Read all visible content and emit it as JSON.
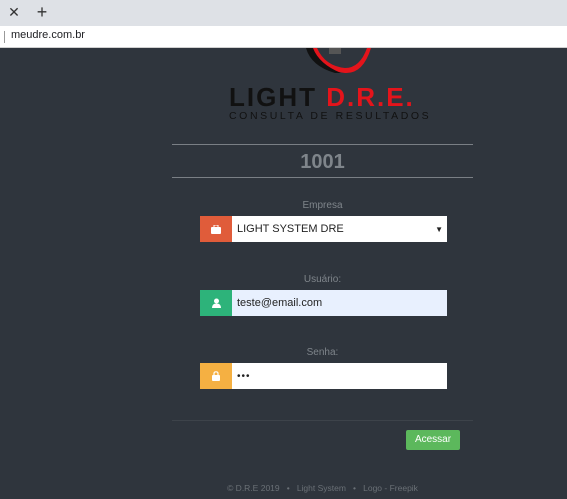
{
  "browser": {
    "close_tab_label": "✕",
    "new_tab_label": "+",
    "url": "meudre.com.br"
  },
  "logo": {
    "title_black": "LIGHT ",
    "title_red": "D.R.E.",
    "subtitle": "CONSULTA DE RESULTADOS",
    "colors": {
      "red": "#e4141b",
      "black": "#111111"
    }
  },
  "code": "1001",
  "empresa": {
    "label": "Empresa",
    "value": "LIGHT SYSTEM DRE",
    "icon": "briefcase-icon",
    "icon_color": "#e05c3a"
  },
  "usuario": {
    "label": "Usuário:",
    "value": "teste@email.com",
    "icon": "user-icon",
    "icon_color": "#2db37a"
  },
  "senha": {
    "label": "Senha:",
    "value": "•••",
    "icon": "lock-icon",
    "icon_color": "#f5b042"
  },
  "submit": {
    "label": "Acessar",
    "color": "#5cb85c"
  },
  "footer": {
    "copyright": "© D.R.E 2019",
    "sep1": "•",
    "company": "Light System",
    "sep2": "•",
    "credit": "Logo - Freepik"
  }
}
